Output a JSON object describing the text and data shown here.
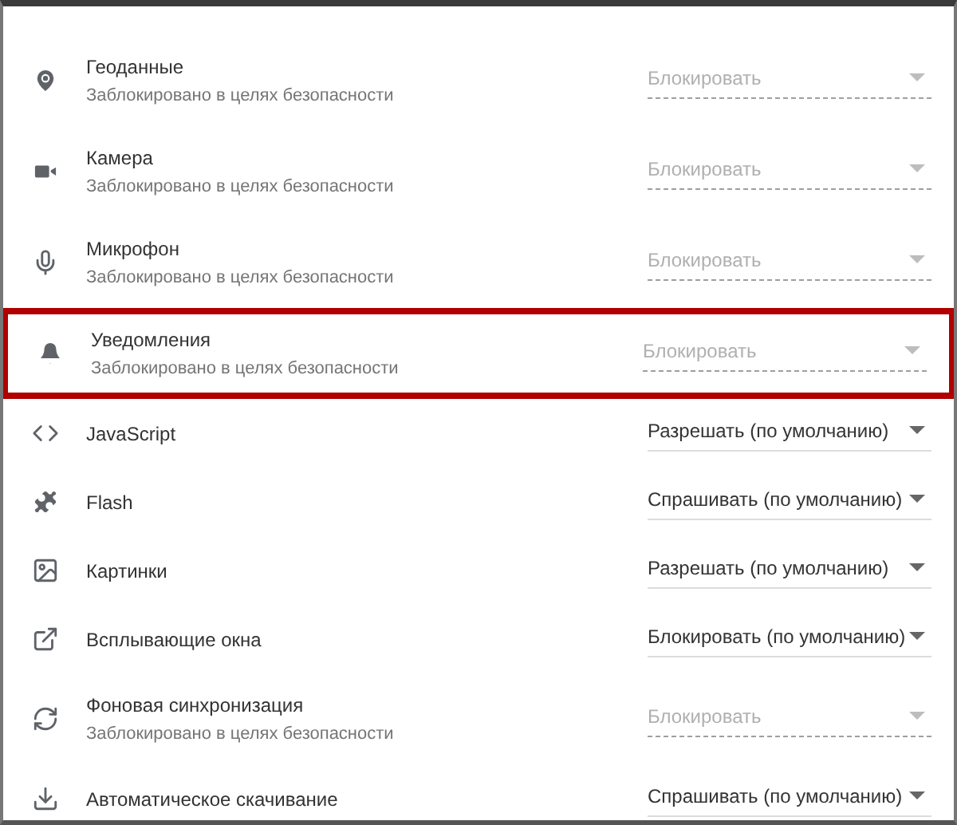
{
  "settings": [
    {
      "kind": "location",
      "title": "Геоданные",
      "subtitle": "Заблокировано в целях безопасности",
      "value": "Блокировать",
      "disabled": true,
      "highlighted": false
    },
    {
      "kind": "camera",
      "title": "Камера",
      "subtitle": "Заблокировано в целях безопасности",
      "value": "Блокировать",
      "disabled": true,
      "highlighted": false
    },
    {
      "kind": "microphone",
      "title": "Микрофон",
      "subtitle": "Заблокировано в целях безопасности",
      "value": "Блокировать",
      "disabled": true,
      "highlighted": false
    },
    {
      "kind": "notifications",
      "title": "Уведомления",
      "subtitle": "Заблокировано в целях безопасности",
      "value": "Блокировать",
      "disabled": true,
      "highlighted": true
    },
    {
      "kind": "javascript",
      "title": "JavaScript",
      "value": "Разрешать (по умолчанию)",
      "disabled": false,
      "highlighted": false
    },
    {
      "kind": "flash",
      "title": "Flash",
      "value": "Спрашивать (по умолчанию)",
      "disabled": false,
      "highlighted": false
    },
    {
      "kind": "images",
      "title": "Картинки",
      "value": "Разрешать (по умолчанию)",
      "disabled": false,
      "highlighted": false
    },
    {
      "kind": "popups",
      "title": "Всплывающие окна",
      "value": "Блокировать (по умолчанию)",
      "disabled": false,
      "highlighted": false
    },
    {
      "kind": "sync",
      "title": "Фоновая синхронизация",
      "subtitle": "Заблокировано в целях безопасности",
      "value": "Блокировать",
      "disabled": true,
      "highlighted": false
    },
    {
      "kind": "download",
      "title": "Автоматическое скачивание",
      "value": "Спрашивать (по умолчанию)",
      "disabled": false,
      "highlighted": false
    }
  ]
}
